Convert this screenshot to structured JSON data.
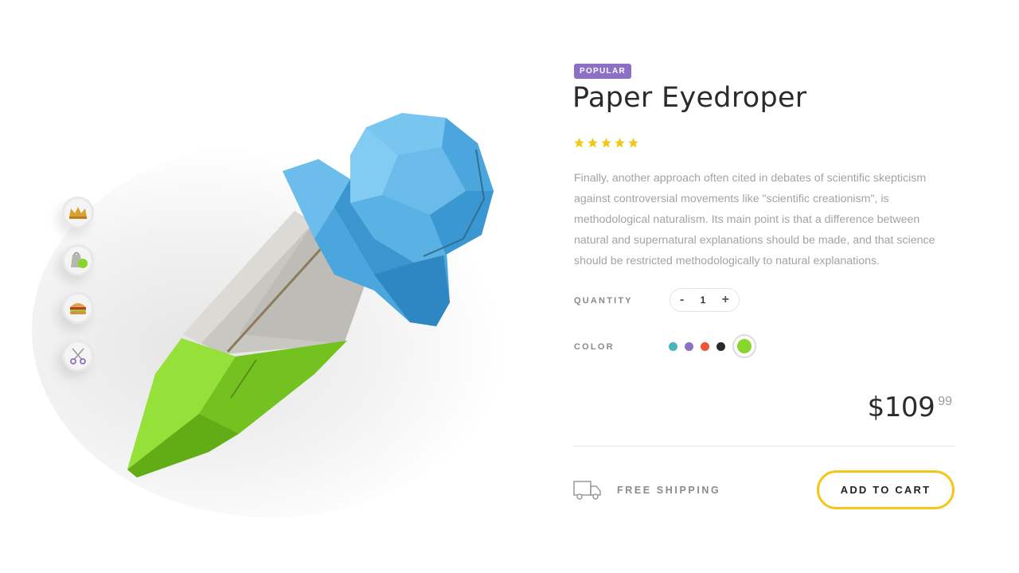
{
  "product": {
    "badge": "POPULAR",
    "title": "Paper Eyedroper",
    "rating": 5,
    "rating_max": 5,
    "description": "Finally, another approach often cited in debates of scientific skepticism against controversial movements like \"scientific creationism\", is methodological naturalism. Its main point is that a difference between natural and supernatural explanations should be made, and that science should be restricted methodologically to natural explanations.",
    "image_icon": "paper-eyedropper-illustration"
  },
  "thumbnails": [
    {
      "icon": "crown-icon"
    },
    {
      "icon": "paper-bag-icon"
    },
    {
      "icon": "burger-icon"
    },
    {
      "icon": "scissors-icon"
    }
  ],
  "quantity": {
    "label": "QUANTITY",
    "value": "1",
    "minus": "-",
    "plus": "+"
  },
  "color": {
    "label": "COLOR",
    "options": [
      "#4ab3bd",
      "#8c6fc6",
      "#ee5535",
      "#2a2a2a",
      "#86d62c"
    ],
    "selected": "#86d62c"
  },
  "price": {
    "main": "$109",
    "cents": "99"
  },
  "shipping": {
    "label": "FREE SHIPPING",
    "icon": "truck-icon"
  },
  "cart": {
    "label": "ADD TO CART"
  },
  "colors": {
    "badge": "#8c6fc6",
    "star": "#f5c518",
    "cart_border": "#f5c518"
  }
}
